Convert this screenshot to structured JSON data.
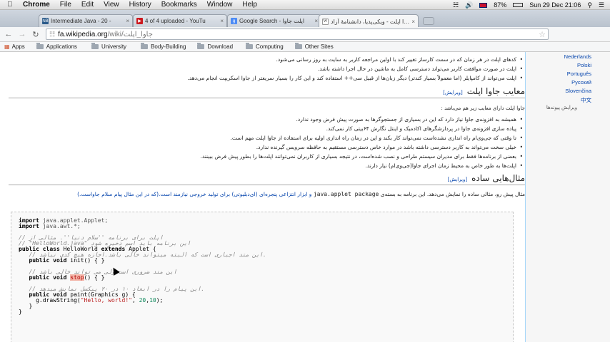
{
  "menubar": {
    "app_name": "Chrome",
    "items": [
      "File",
      "Edit",
      "View",
      "History",
      "Bookmarks",
      "Window",
      "Help"
    ],
    "battery": "87%",
    "datetime": "Sun 29 Dec  21:06"
  },
  "tabs": [
    {
      "label": "Intermediate Java - 20 -",
      "favicon": "NB",
      "favicon_color": "#2a5a8a"
    },
    {
      "label": "4 of 4 uploaded - YouTu",
      "favicon": "▶",
      "favicon_color": "#cc181e"
    },
    {
      "label": "Google Search - اپلت جاوا",
      "favicon": "g",
      "favicon_color": "#4c8bf5"
    },
    {
      "label": "جاوا اپلت - ویکی‌پدیا، دانشنامهٔ آزاد",
      "favicon": "W",
      "favicon_color": "#555555"
    }
  ],
  "toolbar": {
    "url_host": "fa.wikipedia.org",
    "url_path": "/wiki/جاوا_اپلت"
  },
  "bookmarks": {
    "apps_label": "Apps",
    "folders": [
      "Applications",
      "University",
      "Body-Building",
      "Download",
      "Computing",
      "Other Sites"
    ]
  },
  "sidebar": {
    "languages": [
      "Nederlands",
      "Polski",
      "Português",
      "Русский",
      "Slovenčina",
      "中文"
    ],
    "edit_links": "ویرایش پیوندها"
  },
  "article": {
    "top_bullets": [
      "کدهای اپلت در هر زمان که در سمت کارساز تغییر کند با اولین مراجعه کاربر به سایت به روز رسانی می‌شود.",
      "اپلت در صورت موافقت کاربر می‌تواند دسترسی کامل به ماشین در حال اجرا داشته باشد.",
      "اپلت می‌تواند از کامپایلر (اما معمولاً بسیار کندتر) دیگر زبان‌ها از قبیل سی++ استفاده کند و این کار را بسیار سریعتر از جاوا اسکریپت انجام می‌دهد."
    ],
    "section1_title": "معایب جاوا اپلت",
    "edit_label": "[ویرایش]",
    "section1_intro": "جاوا اپلت دارای معایب زیر هم می‌باشد :",
    "section1_bullets": [
      "همیشه به افزونه‌ی جاوا نیاز دارد که این در بسیاری از جستجوگرها به صورت پیش فرض وجود ندارد.",
      "پیاده سازی افزونه‌ی جاوا در پردازشگرهای اکادمیک و اینتل نگارش ۶۴بیتی کار نمی‌کند.",
      "تا وقتی که جی‌وی‌ام راه اندازی نشده‌است نمی‌تواند کار بکند و این در زمان راه اندازی اولیه برای استفاده از جاوا اپلت مهم است.",
      "خیلی سخت می‌تواند به کاربر دسترسی داشته باشد در موارد خاص دسترسی مستقیم به حافظه سرویس گیرنده ندارد.",
      "بعضی از برنامه‌ها فقط برای مدیران سیستم طراحی و نصب شده‌است، در نتیجه بسیاری از کاربران نمی‌توانند اپلت‌ها را بطور پیش فرض ببینند.",
      "اپلت‌ها به طور خاص به محیط زمان اجرای جاوا(جی‌وی‌ام) نیاز دارند."
    ],
    "section2_title": "مثال‌هایی ساده",
    "section2_para_a": "مثال پیش رو، مثالی ساده را نمایش می‌دهد. این برنامه به بسته‌ی",
    "section2_code_pkg": "java.applet package",
    "section2_para_b": "و ابزار انتزاعی پنجره‌ای (ای‌دبلیوتی) برای تولید خروجی نیازمند است.(که در این مثال پیام سلام جاواست.)"
  },
  "code": {
    "lines": [
      {
        "t": "import_line",
        "kw": "import",
        "rest": " java.applet.Applet;"
      },
      {
        "t": "import_line",
        "kw": "import",
        "rest": " java.awt.*;"
      },
      {
        "t": "blank"
      },
      {
        "t": "comment",
        "text": "// اپلت برای برنامه ''سلام دنیا''. مثالی از"
      },
      {
        "t": "comment",
        "text": "// \"HelloWorld.java\" این برنامه باید اسم ذخیره شود"
      },
      {
        "t": "classdecl",
        "a": "public class",
        "b": " HelloWorld ",
        "c": "extends",
        "d": " Applet {"
      },
      {
        "t": "comment",
        "text": "   // این متد اجباری است که البته میتواند خالی باشد.اجازه هیچ کدی نباشد."
      },
      {
        "t": "method",
        "a": "   public void",
        "b": " init() { }"
      },
      {
        "t": "blank"
      },
      {
        "t": "comment",
        "text": "   // این متد ضروری است ولی می تواند خالی باشد"
      },
      {
        "t": "stopline",
        "a": "   public void",
        "b": " ",
        "c": "stop",
        "d": "() { }"
      },
      {
        "t": "blank"
      },
      {
        "t": "comment",
        "text": "   // این پیام را در ابعاد ۱۰ در ۲۰ پیکسل نمایش میدهد."
      },
      {
        "t": "paint",
        "a": "   public void",
        "b": " paint(Graphics g) {"
      },
      {
        "t": "drawstr",
        "a": "     g.drawString(",
        "b": "\"Hello, world!\"",
        "c": ", ",
        "d": "20",
        "e": ",",
        "f": "10",
        "g": ");"
      },
      {
        "t": "plain",
        "text": "   }"
      },
      {
        "t": "plain",
        "text": "}"
      }
    ]
  }
}
